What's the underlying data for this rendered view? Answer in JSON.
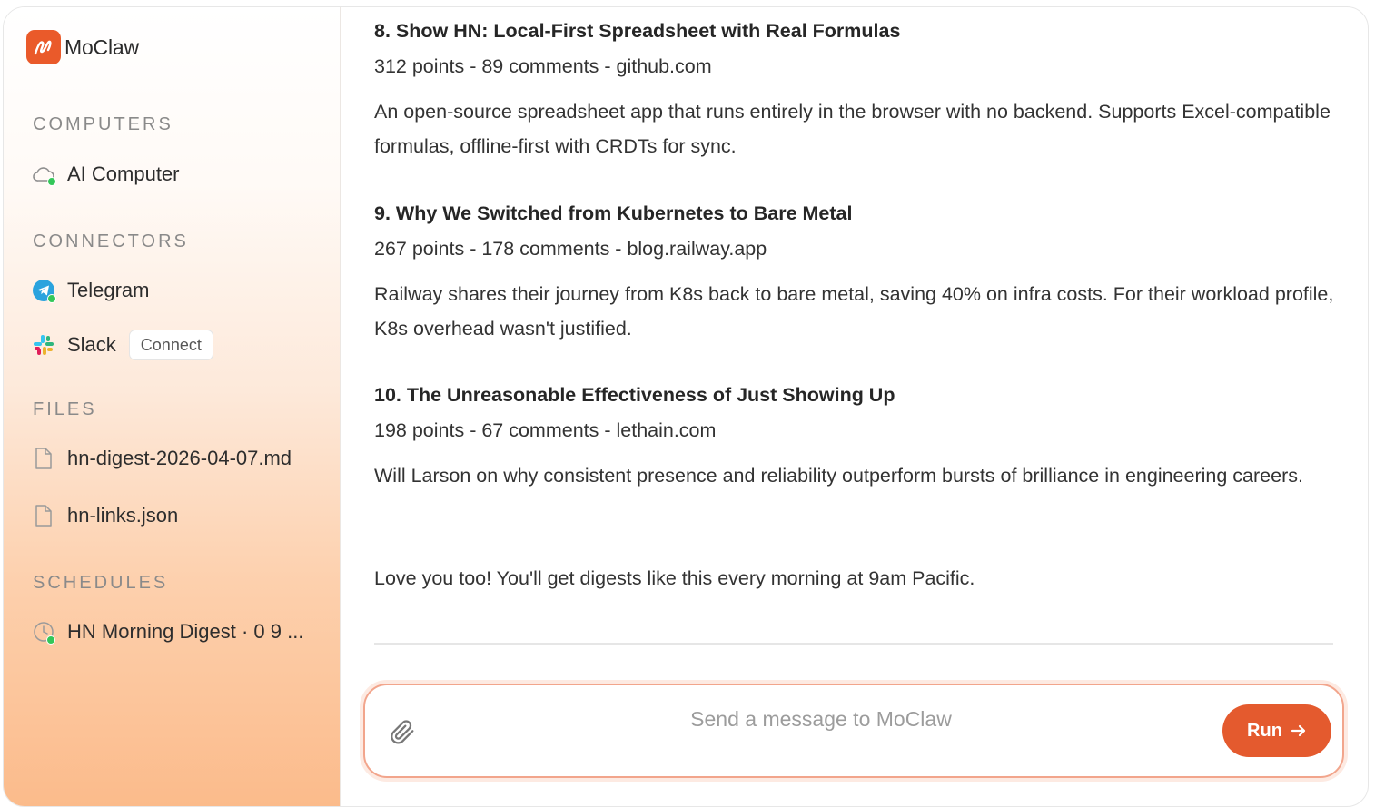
{
  "app": {
    "name": "MoClaw",
    "accent_color": "#e45a2e"
  },
  "sidebar": {
    "computers": {
      "heading": "COMPUTERS",
      "items": [
        {
          "label": "AI Computer",
          "icon": "cloud-icon",
          "status": "online"
        }
      ]
    },
    "connectors": {
      "heading": "CONNECTORS",
      "items": [
        {
          "label": "Telegram",
          "icon": "telegram-icon",
          "status": "online"
        },
        {
          "label": "Slack",
          "icon": "slack-icon",
          "action_label": "Connect"
        }
      ]
    },
    "files": {
      "heading": "FILES",
      "items": [
        {
          "label": "hn-digest-2026-04-07.md",
          "icon": "file-icon"
        },
        {
          "label": "hn-links.json",
          "icon": "file-icon"
        }
      ]
    },
    "schedules": {
      "heading": "SCHEDULES",
      "items": [
        {
          "label": "HN Morning Digest · 0 9 ...",
          "icon": "clock-icon",
          "status": "active"
        }
      ]
    }
  },
  "chat": {
    "stories": [
      {
        "title": "8. Show HN: Local-First Spreadsheet with Real Formulas",
        "meta": "312 points - 89 comments - github.com",
        "description": "An open-source spreadsheet app that runs entirely in the browser with no backend. Supports Excel-compatible formulas, offline-first with CRDTs for sync."
      },
      {
        "title": "9. Why We Switched from Kubernetes to Bare Metal",
        "meta": "267 points - 178 comments - blog.railway.app",
        "description": "Railway shares their journey from K8s back to bare metal, saving 40% on infra costs. For their workload profile, K8s overhead wasn't justified."
      },
      {
        "title": "10. The Unreasonable Effectiveness of Just Showing Up",
        "meta": "198 points - 67 comments - lethain.com",
        "description": "Will Larson on why consistent presence and reliability outperform bursts of brilliance in engineering careers."
      }
    ],
    "closing": "Love you too! You'll get digests like this every morning at 9am Pacific."
  },
  "composer": {
    "placeholder": "Send a message to MoClaw",
    "value": "",
    "run_label": "Run"
  }
}
